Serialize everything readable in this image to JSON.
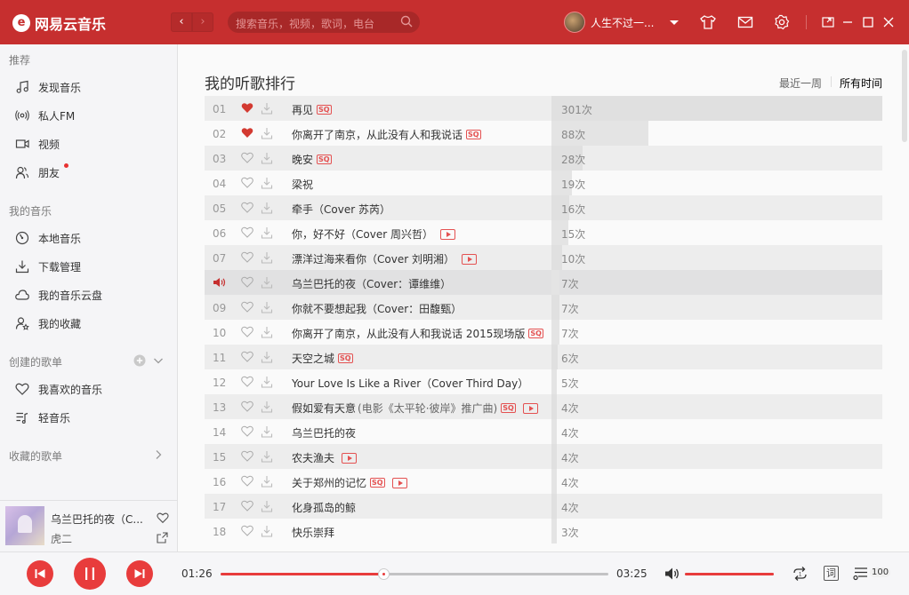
{
  "app": {
    "logo_text": "网易云音乐"
  },
  "header": {
    "search_placeholder": "搜索音乐，视频，歌词，电台",
    "username": "人生不过一..."
  },
  "sidebar": {
    "sections": [
      {
        "title": "推荐",
        "items": [
          "发现音乐",
          "私人FM",
          "视频",
          "朋友"
        ]
      },
      {
        "title": "我的音乐",
        "items": [
          "本地音乐",
          "下载管理",
          "我的音乐云盘",
          "我的收藏"
        ]
      },
      {
        "title": "创建的歌单",
        "items": [
          "我喜欢的音乐",
          "轻音乐"
        ]
      },
      {
        "title": "收藏的歌单",
        "items": []
      }
    ],
    "now_playing": {
      "title": "乌兰巴托的夜（C...",
      "artist": "虎二"
    }
  },
  "main": {
    "title": "我的听歌排行",
    "period_week": "最近一周",
    "period_all": "所有时间",
    "rows": [
      {
        "num": "01",
        "liked": true,
        "title": "再见",
        "sub": "",
        "sq": true,
        "mv": false,
        "count": "301次",
        "ratio": 1.0
      },
      {
        "num": "02",
        "liked": true,
        "title": "你离开了南京，从此没有人和我说话",
        "sub": "",
        "sq": true,
        "mv": false,
        "count": "88次",
        "ratio": 0.292
      },
      {
        "num": "03",
        "liked": false,
        "title": "晚安",
        "sub": "",
        "sq": true,
        "mv": false,
        "count": "28次",
        "ratio": 0.093
      },
      {
        "num": "04",
        "liked": false,
        "title": "梁祝",
        "sub": "",
        "sq": false,
        "mv": false,
        "count": "19次",
        "ratio": 0.063
      },
      {
        "num": "05",
        "liked": false,
        "title": "牵手（Cover 苏芮）",
        "sub": "",
        "sq": false,
        "mv": false,
        "count": "16次",
        "ratio": 0.053
      },
      {
        "num": "06",
        "liked": false,
        "title": "你，好不好（Cover 周兴哲）",
        "sub": "",
        "sq": false,
        "mv": true,
        "count": "15次",
        "ratio": 0.05
      },
      {
        "num": "07",
        "liked": false,
        "title": "漂洋过海来看你（Cover 刘明湘）",
        "sub": "",
        "sq": false,
        "mv": true,
        "count": "10次",
        "ratio": 0.033
      },
      {
        "num": "08",
        "liked": false,
        "title": "乌兰巴托的夜（Cover：谭维维）",
        "sub": "",
        "sq": false,
        "mv": false,
        "count": "7次",
        "ratio": 0.023,
        "playing": true
      },
      {
        "num": "09",
        "liked": false,
        "title": "你就不要想起我（Cover：田馥甄）",
        "sub": "",
        "sq": false,
        "mv": false,
        "count": "7次",
        "ratio": 0.023
      },
      {
        "num": "10",
        "liked": false,
        "title": "你离开了南京，从此没有人和我说话 2015现场版",
        "sub": "",
        "sq": true,
        "mv": false,
        "count": "7次",
        "ratio": 0.023
      },
      {
        "num": "11",
        "liked": false,
        "title": "天空之城",
        "sub": "",
        "sq": true,
        "mv": false,
        "count": "6次",
        "ratio": 0.02
      },
      {
        "num": "12",
        "liked": false,
        "title": "Your Love Is Like a River（Cover Third Day）",
        "sub": "",
        "sq": false,
        "mv": false,
        "count": "5次",
        "ratio": 0.017
      },
      {
        "num": "13",
        "liked": false,
        "title": "假如爱有天意",
        "sub": "(电影《太平轮·彼岸》推广曲)",
        "sq": true,
        "mv": true,
        "count": "4次",
        "ratio": 0.013
      },
      {
        "num": "14",
        "liked": false,
        "title": "乌兰巴托的夜",
        "sub": "",
        "sq": false,
        "mv": false,
        "count": "4次",
        "ratio": 0.013
      },
      {
        "num": "15",
        "liked": false,
        "title": "农夫渔夫",
        "sub": "",
        "sq": false,
        "mv": true,
        "count": "4次",
        "ratio": 0.013
      },
      {
        "num": "16",
        "liked": false,
        "title": "关于郑州的记忆",
        "sub": "",
        "sq": true,
        "mv": true,
        "count": "4次",
        "ratio": 0.013
      },
      {
        "num": "17",
        "liked": false,
        "title": "化身孤岛的鲸",
        "sub": "",
        "sq": false,
        "mv": false,
        "count": "4次",
        "ratio": 0.013
      },
      {
        "num": "18",
        "liked": false,
        "title": "快乐崇拜",
        "sub": "",
        "sq": false,
        "mv": false,
        "count": "3次",
        "ratio": 0.01
      }
    ]
  },
  "player": {
    "current_time": "01:26",
    "total_time": "03:25",
    "progress": 0.42,
    "volume": 1.0,
    "lyric_label": "词",
    "playlist_count": "100"
  },
  "colors": {
    "brand": "#c62f2f",
    "accent": "#e83c3c"
  }
}
